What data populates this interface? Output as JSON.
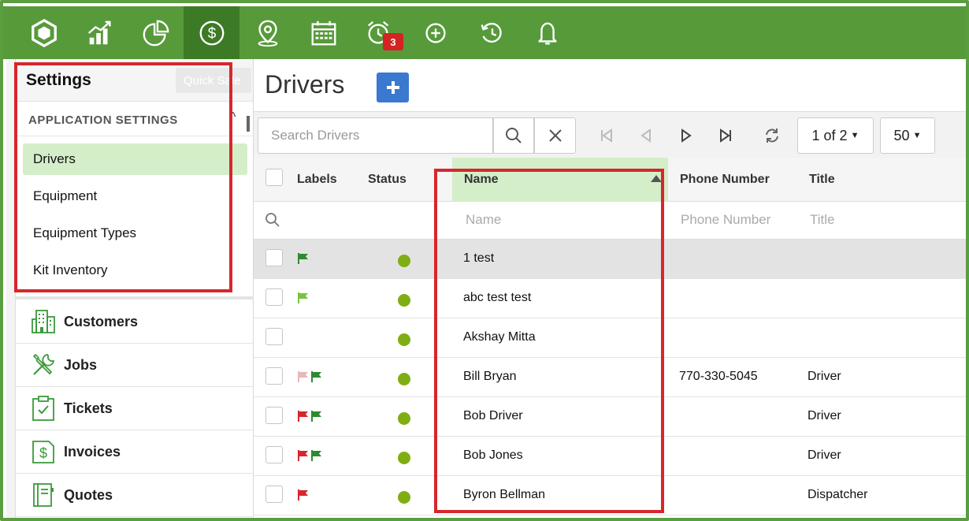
{
  "nav": {
    "items": [
      {
        "icon": "hexagon-logo-icon"
      },
      {
        "icon": "chart-up-icon"
      },
      {
        "icon": "pie-chart-icon"
      },
      {
        "icon": "dollar-icon",
        "active": true
      },
      {
        "icon": "map-pin-icon"
      },
      {
        "icon": "calendar-icon"
      },
      {
        "icon": "alarm-clock-icon",
        "badge": "3"
      },
      {
        "icon": "plus-circle-icon"
      },
      {
        "icon": "history-icon"
      },
      {
        "icon": "bell-icon"
      }
    ],
    "accent": "#579a3a",
    "active_bg": "#3d7a25"
  },
  "sidebar": {
    "title": "Settings",
    "quick_sale": "Quick Sale",
    "section_label": "APPLICATION SETTINGS",
    "items": [
      {
        "label": "Drivers",
        "active": true
      },
      {
        "label": "Equipment"
      },
      {
        "label": "Equipment Types"
      },
      {
        "label": "Kit Inventory"
      }
    ],
    "modules": [
      {
        "label": "Customers",
        "icon": "building-icon"
      },
      {
        "label": "Jobs",
        "icon": "tools-icon"
      },
      {
        "label": "Tickets",
        "icon": "clipboard-check-icon"
      },
      {
        "label": "Invoices",
        "icon": "invoice-dollar-icon"
      },
      {
        "label": "Quotes",
        "icon": "notebook-icon"
      }
    ]
  },
  "main": {
    "title": "Drivers",
    "search_placeholder": "Search Drivers",
    "page_label": "1 of 2",
    "page_size": "50",
    "columns": {
      "labels": "Labels",
      "status": "Status",
      "name": "Name",
      "phone": "Phone Number",
      "title": "Title"
    },
    "filters": {
      "name": "Name",
      "phone": "Phone Number",
      "title": "Title"
    },
    "rows": [
      {
        "name": "1 test",
        "phone": "",
        "title": "",
        "flags": [
          "green"
        ],
        "highlight": true
      },
      {
        "name": "abc test test",
        "phone": "",
        "title": "",
        "flags": [
          "lightgreen"
        ]
      },
      {
        "name": "Akshay Mitta",
        "phone": "",
        "title": "",
        "flags": []
      },
      {
        "name": "Bill Bryan",
        "phone": "770-330-5045",
        "title": "Driver",
        "flags": [
          "pink",
          "green"
        ]
      },
      {
        "name": "Bob Driver",
        "phone": "",
        "title": "Driver",
        "flags": [
          "red",
          "green"
        ]
      },
      {
        "name": "Bob Jones",
        "phone": "",
        "title": "Driver",
        "flags": [
          "red",
          "green"
        ]
      },
      {
        "name": "Byron Bellman",
        "phone": "",
        "title": "Dispatcher",
        "flags": [
          "red"
        ]
      }
    ]
  },
  "colors": {
    "flag_green": "#2f8a2f",
    "flag_lightgreen": "#7cc242",
    "flag_red": "#d7262c",
    "flag_pink": "#e6b8b8",
    "status_green": "#7fae12",
    "highlight_red": "#d7262c"
  }
}
